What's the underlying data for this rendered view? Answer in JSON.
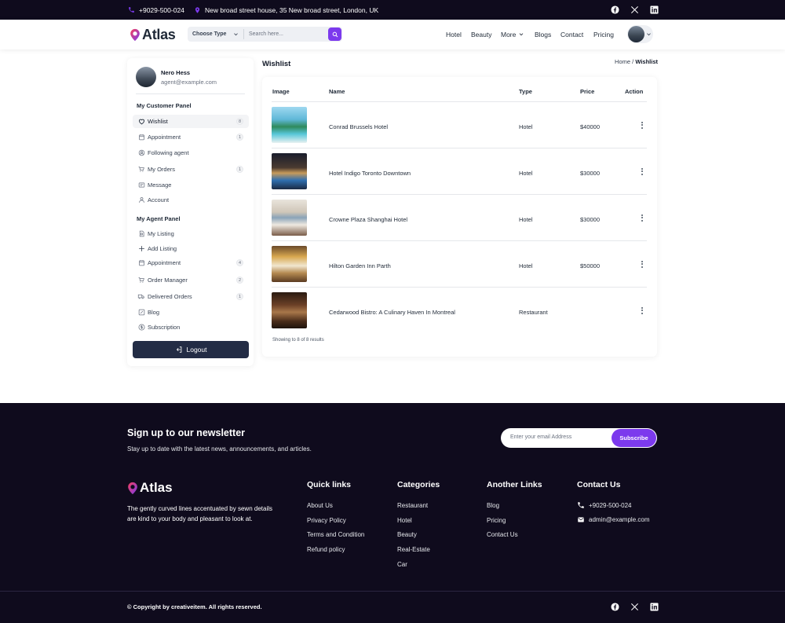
{
  "topbar": {
    "phone": "+9029-500-024",
    "address": "New broad street house, 35 New broad street, London, UK",
    "social_icons": [
      "facebook-icon",
      "x-icon",
      "linkedin-icon"
    ]
  },
  "header": {
    "logo_text": "Atlas",
    "search_type": "Choose Type",
    "search_placeholder": "Search here...",
    "nav": [
      "Hotel",
      "Beauty",
      "More",
      "Blogs",
      "Contact",
      "Pricing"
    ],
    "accent": "#7c3aed"
  },
  "sidebar": {
    "user_name": "Nero Hess",
    "user_email": "agent@example.com",
    "customer_panel_title": "My Customer Panel",
    "customer_items": [
      {
        "label": "Wishlist",
        "icon": "heart-icon",
        "badge": "8",
        "active": true
      },
      {
        "label": "Appointment",
        "icon": "calendar-icon",
        "badge": "1"
      },
      {
        "label": "Following agent",
        "icon": "user-plus-icon",
        "badge": ""
      },
      {
        "label": "My Orders",
        "icon": "cart-icon",
        "badge": "1"
      },
      {
        "label": "Message",
        "icon": "message-icon",
        "badge": ""
      },
      {
        "label": "Account",
        "icon": "user-icon",
        "badge": ""
      }
    ],
    "agent_panel_title": "My Agent Panel",
    "agent_items": [
      {
        "label": "My Listing",
        "icon": "listing-icon",
        "badge": ""
      },
      {
        "label": "Add Listing",
        "icon": "plus-icon",
        "badge": ""
      },
      {
        "label": "Appointment",
        "icon": "calendar-icon",
        "badge": "4"
      },
      {
        "label": "Order Manager",
        "icon": "cart-icon",
        "badge": "2"
      },
      {
        "label": "Delivered Orders",
        "icon": "truck-icon",
        "badge": "1"
      },
      {
        "label": "Blog",
        "icon": "edit-icon",
        "badge": ""
      },
      {
        "label": "Subscription",
        "icon": "dollar-icon",
        "badge": ""
      }
    ],
    "logout_label": "Logout"
  },
  "main": {
    "title": "Wishlist",
    "breadcrumb_home": "Home",
    "breadcrumb_current": "Wishlist",
    "columns": [
      "Image",
      "Name",
      "Type",
      "Price",
      "Action"
    ],
    "rows": [
      {
        "name": "Conrad Brussels Hotel",
        "type": "Hotel",
        "price": "$40000"
      },
      {
        "name": "Hotel Indigo Toronto Downtown",
        "type": "Hotel",
        "price": "$30000"
      },
      {
        "name": "Crowne Plaza Shanghai Hotel",
        "type": "Hotel",
        "price": "$30000"
      },
      {
        "name": "Hilton Garden Inn Parth",
        "type": "Hotel",
        "price": "$50000"
      },
      {
        "name": "Cedarwood Bistro: A Culinary Haven In Montreal",
        "type": "Restaurant",
        "price": ""
      }
    ],
    "showing_text": "Showing to 8 of 8 results"
  },
  "footer": {
    "newsletter_title": "Sign up to our newsletter",
    "newsletter_sub": "Stay up to date with the latest news, announcements, and articles.",
    "email_placeholder": "Enter your email Address",
    "subscribe_label": "Subscribe",
    "logo_text": "Atlas",
    "description": "The gently curved lines accentuated by sewn details are kind to your body and pleasant to look at.",
    "quick_links_title": "Quick links",
    "quick_links": [
      "About Us",
      "Privacy Policy",
      "Terms and Condition",
      "Refund policy"
    ],
    "categories_title": "Categories",
    "categories": [
      "Restaurant",
      "Hotel",
      "Beauty",
      "Real-Estate",
      "Car"
    ],
    "another_links_title": "Another Links",
    "another_links": [
      "Blog",
      "Pricing",
      "Contact Us"
    ],
    "contact_title": "Contact Us",
    "contact_phone": "+9029-500-024",
    "contact_email": "admin@example.com",
    "copyright": "© Copyright by creativeitem. All rights reserved."
  }
}
